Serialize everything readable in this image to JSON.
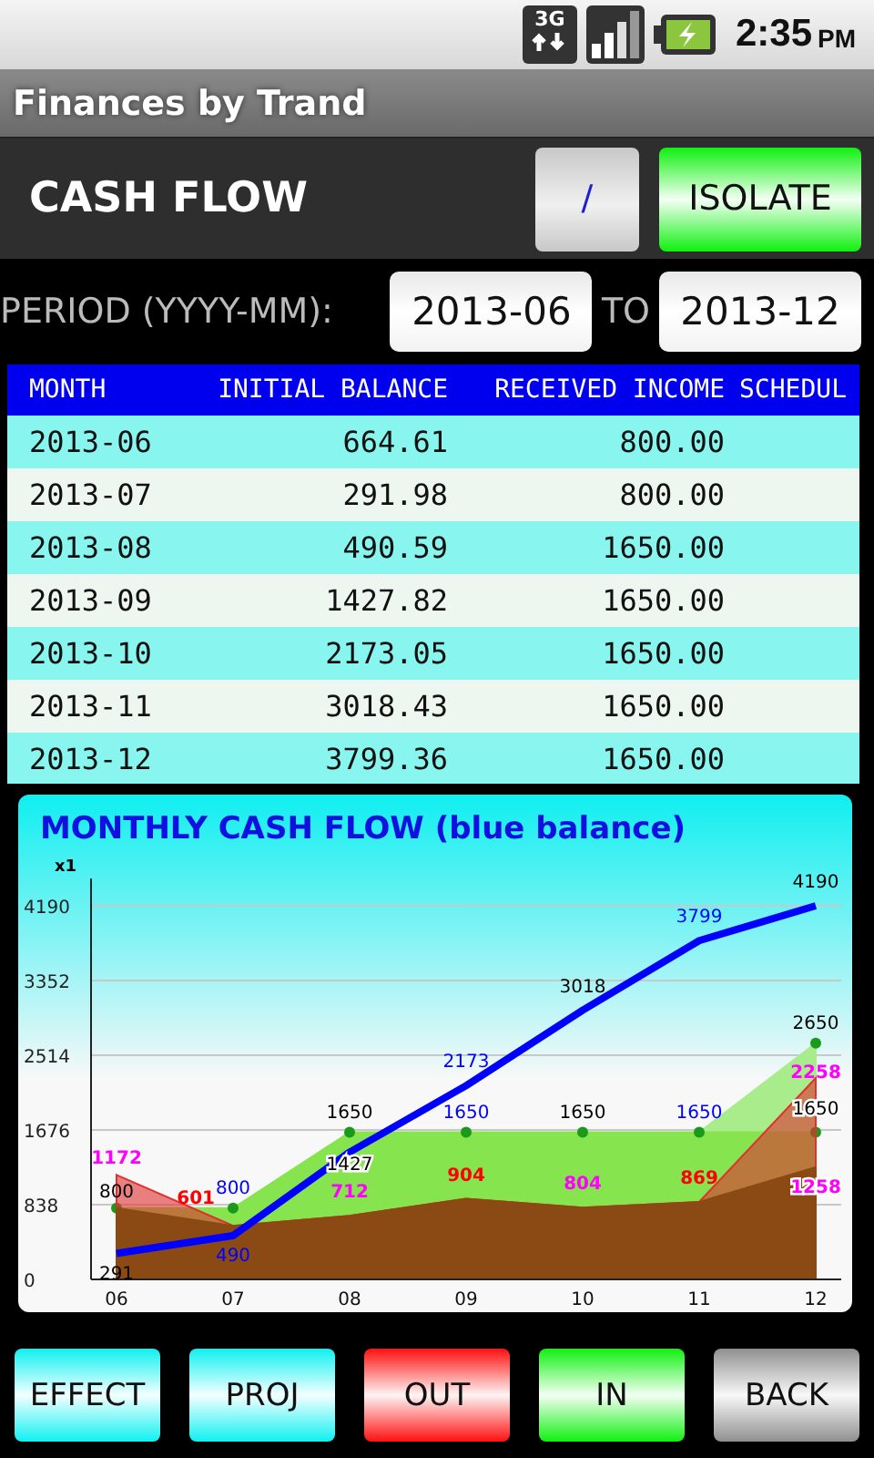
{
  "status_bar": {
    "network": "3G",
    "time": "2:35",
    "ampm": "PM"
  },
  "window": {
    "title": "Finances by Trand"
  },
  "header": {
    "title": "CASH FLOW",
    "buttons": [
      {
        "label": "/",
        "kind": "plain"
      },
      {
        "label": "ISOLATE",
        "kind": "green"
      }
    ]
  },
  "period": {
    "label": "PERIOD (YYYY-MM):",
    "from": "2013-06",
    "separator": "TO",
    "to": "2013-12"
  },
  "table": {
    "columns": [
      "MONTH",
      "INITIAL BALANCE",
      "RECEIVED INCOME",
      "SCHEDUL"
    ],
    "rows": [
      [
        "2013-06",
        "664.61",
        "800.00"
      ],
      [
        "2013-07",
        "291.98",
        "800.00"
      ],
      [
        "2013-08",
        "490.59",
        "1650.00"
      ],
      [
        "2013-09",
        "1427.82",
        "1650.00"
      ],
      [
        "2013-10",
        "2173.05",
        "1650.00"
      ],
      [
        "2013-11",
        "3018.43",
        "1650.00"
      ],
      [
        "2013-12",
        "3799.36",
        "1650.00"
      ]
    ]
  },
  "chart": {
    "chart_data": {
      "type": "area",
      "title": "MONTHLY CASH FLOW (blue balance)",
      "ylabel": "x1",
      "categories": [
        "06",
        "07",
        "08",
        "09",
        "10",
        "11",
        "12"
      ],
      "ylim": [
        0,
        4190
      ],
      "grid": true,
      "yticks": [
        0,
        838,
        1676,
        2514,
        3352,
        4190
      ],
      "series": [
        {
          "type": "area",
          "color": "#a8ec8c",
          "values": [
            null,
            null,
            null,
            null,
            null,
            1650,
            2650
          ],
          "value_labels": [
            null,
            null,
            null,
            null,
            null,
            null,
            "2650"
          ]
        },
        {
          "type": "area",
          "color": "#86e44e",
          "values": [
            800,
            800,
            1650,
            1650,
            1650,
            1650,
            1650
          ],
          "value_labels": [
            "800",
            "800",
            "1650",
            "1650",
            "1650",
            "1650",
            "1650"
          ]
        },
        {
          "type": "area",
          "color": "#e03030",
          "values": [
            1172,
            601,
            712,
            904,
            804,
            869,
            2258
          ],
          "value_labels": [
            "1172",
            "601",
            "712",
            "904",
            "804",
            "869",
            "2258"
          ]
        },
        {
          "type": "area",
          "color": "#8b4a14",
          "values": [
            800,
            601,
            712,
            904,
            804,
            869,
            1258
          ],
          "value_labels": [
            null,
            null,
            null,
            null,
            null,
            null,
            "1258"
          ]
        },
        {
          "type": "line",
          "color": "#0000ff",
          "values": [
            291,
            490,
            1427,
            2173,
            3018,
            3799,
            4190
          ],
          "value_labels": [
            "291",
            "490",
            "1427",
            "2173",
            "3018",
            "3799",
            "4190"
          ]
        }
      ]
    }
  },
  "buttons": [
    {
      "label": "EFFECT",
      "kind": "cyan"
    },
    {
      "label": "PROJ",
      "kind": "cyan"
    },
    {
      "label": "OUT",
      "kind": "red"
    },
    {
      "label": "IN",
      "kind": "green"
    },
    {
      "label": "BACK",
      "kind": "gray"
    }
  ]
}
